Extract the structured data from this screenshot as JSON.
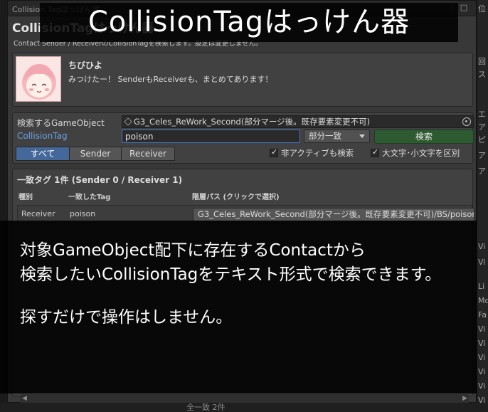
{
  "window": {
    "tab_title": "Collision Tagはっけん器",
    "header_title": "CollisionTagはっけん器",
    "description": "Contact Sender / ReceiverのCollisionTagを検索します。設定は変更しません。"
  },
  "chat": {
    "speaker": "ちびひよ",
    "message": "みつけたー！ SenderもReceiverも、まとめてあります！"
  },
  "search": {
    "object_label": "検索するGameObject",
    "object_value": "G3_Celes_ReWork_Second(部分マージ後。既存要素変更不可)",
    "tag_label": "CollisionTag",
    "tag_value": "poison",
    "match_mode": "部分一致",
    "search_button": "検索",
    "filters": [
      "すべて",
      "Sender",
      "Receiver"
    ],
    "active_filter": "すべて",
    "include_inactive_label": "非アクティブも検索",
    "include_inactive": true,
    "case_sensitive_label": "大文字･小文字を区別",
    "case_sensitive": true
  },
  "results": {
    "summary": "一致タグ 1件 (Sender 0 / Receiver 1)",
    "columns": [
      "種別",
      "一致したTag",
      "階層パス (クリックで選択)"
    ],
    "rows": [
      {
        "kind": "Receiver",
        "tag": "poison",
        "path": "G3_Celes_ReWork_Second(部分マージ後。既存要素変更不可)/BS/poison"
      }
    ]
  },
  "overlay": {
    "banner": "CollisionTagはっけん器",
    "lines": [
      "対象GameObject配下に存在するContactから",
      "検索したいCollisionTagをテキスト形式で検索できます。",
      "",
      "探すだけで操作はしません。"
    ]
  },
  "background": {
    "right_fragments": [
      "位",
      "回",
      "ス",
      "エ",
      "ア",
      "ピ",
      "ア",
      "ア",
      "ア",
      "Vi",
      "Vi",
      "Li",
      "Mo",
      "Fa",
      "Vi",
      "Vi",
      "Vi",
      "Vi",
      "Vi",
      "Vi"
    ],
    "bottom_fragment": "全一致 2件"
  }
}
